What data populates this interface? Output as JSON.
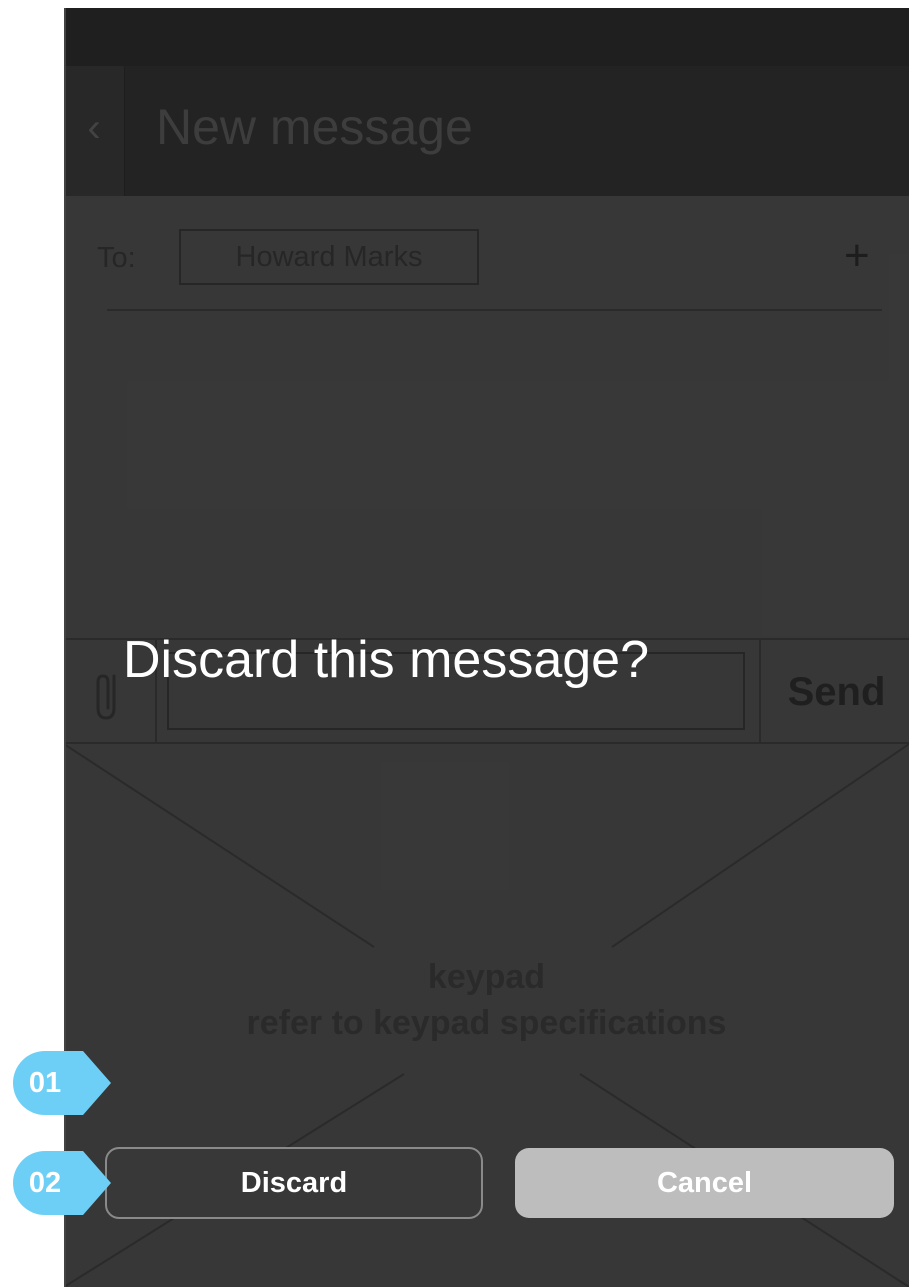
{
  "header": {
    "back_glyph": "‹",
    "title": "New message"
  },
  "recipients": {
    "to_label": "To:",
    "recipient": "Howard Marks",
    "add_glyph": "+"
  },
  "compose": {
    "attach_icon": "paperclip-icon",
    "input_value": "",
    "send_label": "Send"
  },
  "keypad": {
    "line1": "keypad",
    "line2": "refer to keypad specifications"
  },
  "dialog": {
    "message": "Discard this message?",
    "discard_label": "Discard",
    "cancel_label": "Cancel"
  },
  "annotations": {
    "callout_1": "01",
    "callout_2": "02",
    "color": "#6dcff6"
  },
  "colors": {
    "background": "#3d3d3d",
    "header": "#262626",
    "cancel_button": "#bdbdbd",
    "dialog_text": "#ffffff"
  }
}
